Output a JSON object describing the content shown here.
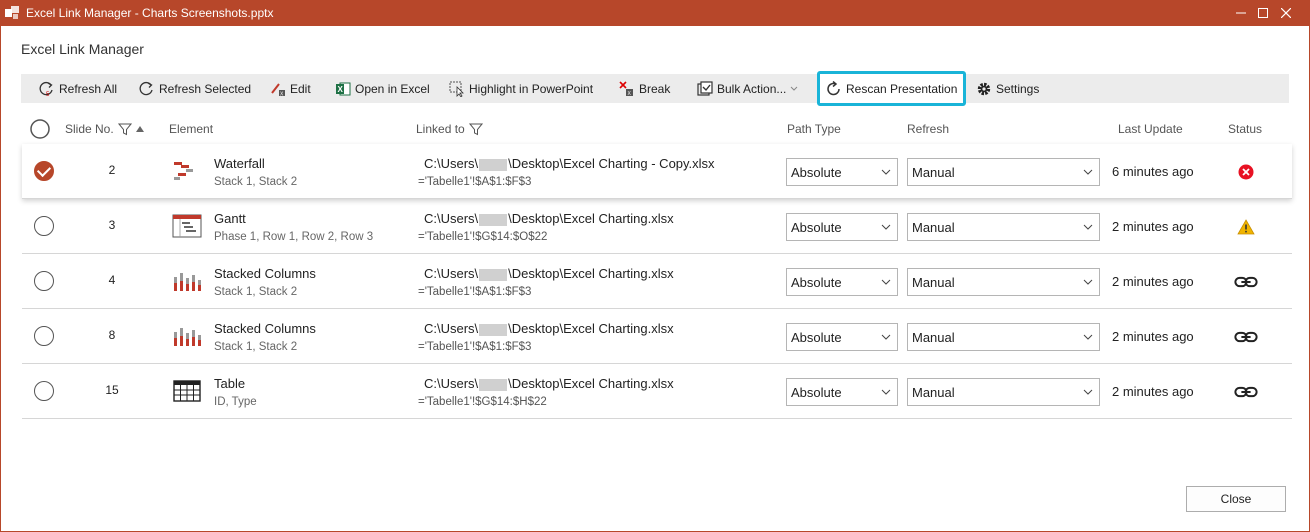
{
  "window": {
    "title": "Excel Link Manager - Charts Screenshots.pptx",
    "minimize_icon": "minimize-icon",
    "maximize_icon": "maximize-icon",
    "close_icon": "close-icon"
  },
  "header": {
    "title": "Excel Link Manager"
  },
  "toolbar": {
    "refresh_all": "Refresh All",
    "refresh_selected": "Refresh Selected",
    "edit": "Edit",
    "open_in_excel": "Open in Excel",
    "highlight": "Highlight in PowerPoint",
    "break": "Break",
    "bulk_actions": "Bulk Action...",
    "rescan": "Rescan Presentation",
    "settings": "Settings"
  },
  "columns": {
    "slide_no": "Slide No.",
    "element": "Element",
    "linked_to": "Linked to",
    "path_type": "Path Type",
    "refresh": "Refresh",
    "last_update": "Last Update",
    "status": "Status"
  },
  "rows": [
    {
      "selected": true,
      "slide": "2",
      "icon": "waterfall-chart-icon",
      "name": "Waterfall",
      "sub": "Stack 1, Stack 2",
      "path_prefix": "C:\\Users\\",
      "path_suffix": "\\Desktop\\Excel Charting - Copy.xlsx",
      "range": "='Tabelle1'!$A$1:$F$3",
      "path_type": "Absolute",
      "refresh": "Manual",
      "last_update": "6 minutes ago",
      "status": "error"
    },
    {
      "selected": false,
      "slide": "3",
      "icon": "gantt-chart-icon",
      "name": "Gantt",
      "sub": "Phase 1, Row 1, Row 2, Row 3",
      "path_prefix": "C:\\Users\\",
      "path_suffix": "\\Desktop\\Excel Charting.xlsx",
      "range": "='Tabelle1'!$G$14:$O$22",
      "path_type": "Absolute",
      "refresh": "Manual",
      "last_update": "2 minutes ago",
      "status": "warning"
    },
    {
      "selected": false,
      "slide": "4",
      "icon": "stacked-column-chart-icon",
      "name": "Stacked Columns",
      "sub": "Stack 1, Stack 2",
      "path_prefix": "C:\\Users\\",
      "path_suffix": "\\Desktop\\Excel Charting.xlsx",
      "range": "='Tabelle1'!$A$1:$F$3",
      "path_type": "Absolute",
      "refresh": "Manual",
      "last_update": "2 minutes ago",
      "status": "linked"
    },
    {
      "selected": false,
      "slide": "8",
      "icon": "stacked-column-chart-icon",
      "name": "Stacked Columns",
      "sub": "Stack 1, Stack 2",
      "path_prefix": "C:\\Users\\",
      "path_suffix": "\\Desktop\\Excel Charting.xlsx",
      "range": "='Tabelle1'!$A$1:$F$3",
      "path_type": "Absolute",
      "refresh": "Manual",
      "last_update": "2 minutes ago",
      "status": "linked"
    },
    {
      "selected": false,
      "slide": "15",
      "icon": "table-icon",
      "name": "Table",
      "sub": "ID, Type",
      "path_prefix": "C:\\Users\\",
      "path_suffix": "\\Desktop\\Excel Charting.xlsx",
      "range": "='Tabelle1'!$G$14:$H$22",
      "path_type": "Absolute",
      "refresh": "Manual",
      "last_update": "2 minutes ago",
      "status": "linked"
    }
  ],
  "footer": {
    "close": "Close"
  },
  "colors": {
    "accent": "#b7472a",
    "highlight": "#19b4d8",
    "error": "#e81123",
    "warning": "#f0b400"
  }
}
